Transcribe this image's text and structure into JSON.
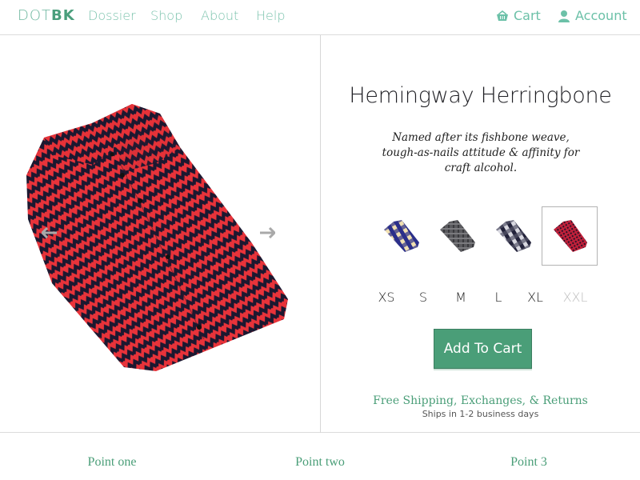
{
  "nav": {
    "logo_light": "DOT",
    "logo_bold": "BK",
    "links": [
      {
        "label": "Dossier"
      },
      {
        "label": "Shop"
      },
      {
        "label": "About"
      },
      {
        "label": "Help"
      }
    ],
    "cart_label": "Cart",
    "cart_icon": "basket-icon",
    "account_label": "Account",
    "account_icon": "user-icon"
  },
  "gallery": {
    "image": "red-black-herringbone-shirt",
    "prev_icon": "arrow-left-icon",
    "next_icon": "arrow-right-icon"
  },
  "product": {
    "title": "Hemingway Herringbone",
    "description": "Named after its fishbone weave, tough-as-nails attitude & affinity for craft alcohol.",
    "swatches": [
      {
        "name": "blue-cream-plaid",
        "selected": false
      },
      {
        "name": "grey-flannel",
        "selected": false
      },
      {
        "name": "black-white-buffalo-check",
        "selected": false
      },
      {
        "name": "red-black-herringbone",
        "selected": true
      }
    ],
    "sizes": [
      {
        "label": "XS",
        "available": true
      },
      {
        "label": "S",
        "available": true
      },
      {
        "label": "M",
        "available": true
      },
      {
        "label": "L",
        "available": true
      },
      {
        "label": "XL",
        "available": true
      },
      {
        "label": "XXL",
        "available": false
      }
    ],
    "add_to_cart_label": "Add To Cart",
    "shipping_title": "Free Shipping, Exchanges, & Returns",
    "shipping_note": "Ships in 1-2 business days"
  },
  "points": [
    {
      "label": "Point one"
    },
    {
      "label": "Point two"
    },
    {
      "label": "Point 3"
    }
  ],
  "colors": {
    "accent": "#4a9e78",
    "nav_link": "#7dc4ae",
    "border": "#dcdcdc",
    "disabled": "#bdbdbd"
  }
}
